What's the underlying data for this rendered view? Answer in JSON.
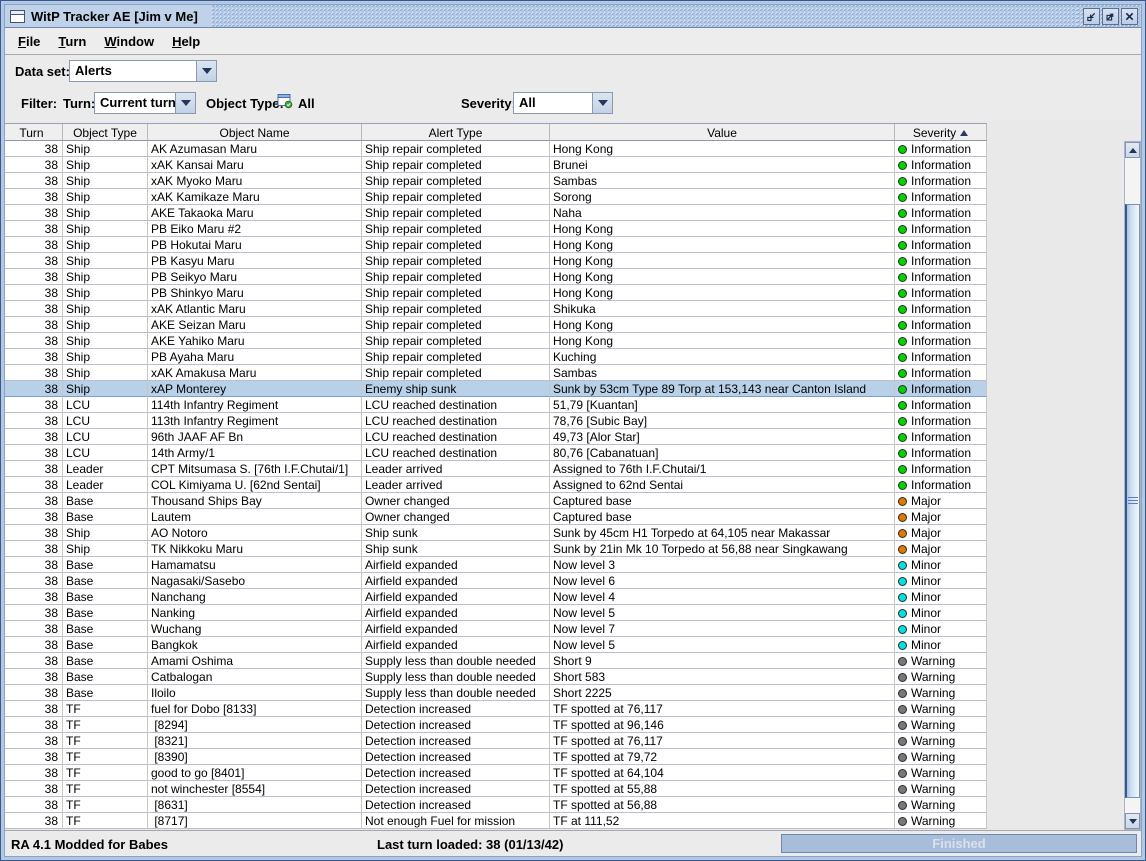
{
  "window": {
    "title": "WitP Tracker AE [Jim v Me]"
  },
  "menu": {
    "items": [
      {
        "label": "File"
      },
      {
        "label": "Turn"
      },
      {
        "label": "Window"
      },
      {
        "label": "Help"
      }
    ]
  },
  "dataset": {
    "label": "Data set:",
    "value": "Alerts"
  },
  "filter": {
    "label": "Filter:",
    "turn_label": "Turn:",
    "turn_value": "Current turn",
    "object_type_label": "Object Type:",
    "object_type_value": "All",
    "severity_label": "Severity:",
    "severity_value": "All"
  },
  "table": {
    "columns": [
      "Turn",
      "Object Type",
      "Object Name",
      "Alert Type",
      "Value",
      "Severity"
    ],
    "sort_column": "Severity",
    "selected_row_index": 15,
    "rows": [
      [
        "38",
        "Ship",
        "AK Azumasan Maru",
        "Ship repair completed",
        "Hong Kong",
        "Information"
      ],
      [
        "38",
        "Ship",
        "xAK Kansai Maru",
        "Ship repair completed",
        "Brunei",
        "Information"
      ],
      [
        "38",
        "Ship",
        "xAK Myoko Maru",
        "Ship repair completed",
        "Sambas",
        "Information"
      ],
      [
        "38",
        "Ship",
        "xAK Kamikaze Maru",
        "Ship repair completed",
        "Sorong",
        "Information"
      ],
      [
        "38",
        "Ship",
        "AKE Takaoka Maru",
        "Ship repair completed",
        "Naha",
        "Information"
      ],
      [
        "38",
        "Ship",
        "PB Eiko Maru #2",
        "Ship repair completed",
        "Hong Kong",
        "Information"
      ],
      [
        "38",
        "Ship",
        "PB Hokutai Maru",
        "Ship repair completed",
        "Hong Kong",
        "Information"
      ],
      [
        "38",
        "Ship",
        "PB Kasyu Maru",
        "Ship repair completed",
        "Hong Kong",
        "Information"
      ],
      [
        "38",
        "Ship",
        "PB Seikyo Maru",
        "Ship repair completed",
        "Hong Kong",
        "Information"
      ],
      [
        "38",
        "Ship",
        "PB Shinkyo Maru",
        "Ship repair completed",
        "Hong Kong",
        "Information"
      ],
      [
        "38",
        "Ship",
        "xAK Atlantic Maru",
        "Ship repair completed",
        "Shikuka",
        "Information"
      ],
      [
        "38",
        "Ship",
        "AKE Seizan Maru",
        "Ship repair completed",
        "Hong Kong",
        "Information"
      ],
      [
        "38",
        "Ship",
        "AKE Yahiko Maru",
        "Ship repair completed",
        "Hong Kong",
        "Information"
      ],
      [
        "38",
        "Ship",
        "PB Ayaha Maru",
        "Ship repair completed",
        "Kuching",
        "Information"
      ],
      [
        "38",
        "Ship",
        "xAK Amakusa Maru",
        "Ship repair completed",
        "Sambas",
        "Information"
      ],
      [
        "38",
        "Ship",
        "xAP Monterey",
        "Enemy ship sunk",
        "Sunk by 53cm Type 89 Torp at 153,143 near Canton Island",
        "Information"
      ],
      [
        "38",
        "LCU",
        "114th Infantry Regiment",
        "LCU reached destination",
        "51,79 [Kuantan]",
        "Information"
      ],
      [
        "38",
        "LCU",
        "113th Infantry Regiment",
        "LCU reached destination",
        "78,76 [Subic Bay]",
        "Information"
      ],
      [
        "38",
        "LCU",
        "96th JAAF AF Bn",
        "LCU reached destination",
        "49,73 [Alor Star]",
        "Information"
      ],
      [
        "38",
        "LCU",
        "14th Army/1",
        "LCU reached destination",
        "80,76 [Cabanatuan]",
        "Information"
      ],
      [
        "38",
        "Leader",
        "CPT Mitsumasa S. [76th I.F.Chutai/1]",
        "Leader arrived",
        "Assigned to 76th I.F.Chutai/1",
        "Information"
      ],
      [
        "38",
        "Leader",
        "COL Kimiyama U. [62nd Sentai]",
        "Leader arrived",
        "Assigned to 62nd Sentai",
        "Information"
      ],
      [
        "38",
        "Base",
        "Thousand Ships Bay",
        "Owner changed",
        "Captured base",
        "Major"
      ],
      [
        "38",
        "Base",
        "Lautem",
        "Owner changed",
        "Captured base",
        "Major"
      ],
      [
        "38",
        "Ship",
        "AO Notoro",
        "Ship sunk",
        "Sunk by 45cm H1 Torpedo at 64,105 near Makassar",
        "Major"
      ],
      [
        "38",
        "Ship",
        "TK Nikkoku Maru",
        "Ship sunk",
        "Sunk by 21in Mk 10 Torpedo at 56,88 near Singkawang",
        "Major"
      ],
      [
        "38",
        "Base",
        "Hamamatsu",
        "Airfield expanded",
        "Now level 3",
        "Minor"
      ],
      [
        "38",
        "Base",
        "Nagasaki/Sasebo",
        "Airfield expanded",
        "Now level 6",
        "Minor"
      ],
      [
        "38",
        "Base",
        "Nanchang",
        "Airfield expanded",
        "Now level 4",
        "Minor"
      ],
      [
        "38",
        "Base",
        "Nanking",
        "Airfield expanded",
        "Now level 5",
        "Minor"
      ],
      [
        "38",
        "Base",
        "Wuchang",
        "Airfield expanded",
        "Now level 7",
        "Minor"
      ],
      [
        "38",
        "Base",
        "Bangkok",
        "Airfield expanded",
        "Now level 5",
        "Minor"
      ],
      [
        "38",
        "Base",
        "Amami Oshima",
        "Supply less than double needed",
        "Short 9",
        "Warning"
      ],
      [
        "38",
        "Base",
        "Catbalogan",
        "Supply less than double needed",
        "Short 583",
        "Warning"
      ],
      [
        "38",
        "Base",
        "Iloilo",
        "Supply less than double needed",
        "Short 2225",
        "Warning"
      ],
      [
        "38",
        "TF",
        "fuel for Dobo [8133]",
        "Detection increased",
        "TF spotted at 76,117",
        "Warning"
      ],
      [
        "38",
        "TF",
        " [8294]",
        "Detection increased",
        "TF spotted at 96,146",
        "Warning"
      ],
      [
        "38",
        "TF",
        " [8321]",
        "Detection increased",
        "TF spotted at 76,117",
        "Warning"
      ],
      [
        "38",
        "TF",
        " [8390]",
        "Detection increased",
        "TF spotted at 79,72",
        "Warning"
      ],
      [
        "38",
        "TF",
        "good to go [8401]",
        "Detection increased",
        "TF spotted at 64,104",
        "Warning"
      ],
      [
        "38",
        "TF",
        "not winchester [8554]",
        "Detection increased",
        "TF spotted at 55,88",
        "Warning"
      ],
      [
        "38",
        "TF",
        " [8631]",
        "Detection increased",
        "TF spotted at 56,88",
        "Warning"
      ],
      [
        "38",
        "TF",
        " [8717]",
        "Not enough Fuel for mission",
        "TF at 111,52",
        "Warning"
      ]
    ]
  },
  "severity_colors": {
    "Information": "#00D400",
    "Major": "#E07800",
    "Minor": "#00E0E0",
    "Warning": "#787878"
  },
  "statusbar": {
    "left": "RA 4.1 Modded for Babes",
    "center": "Last turn loaded: 38 (01/13/42)",
    "progress_label": "Finished"
  }
}
